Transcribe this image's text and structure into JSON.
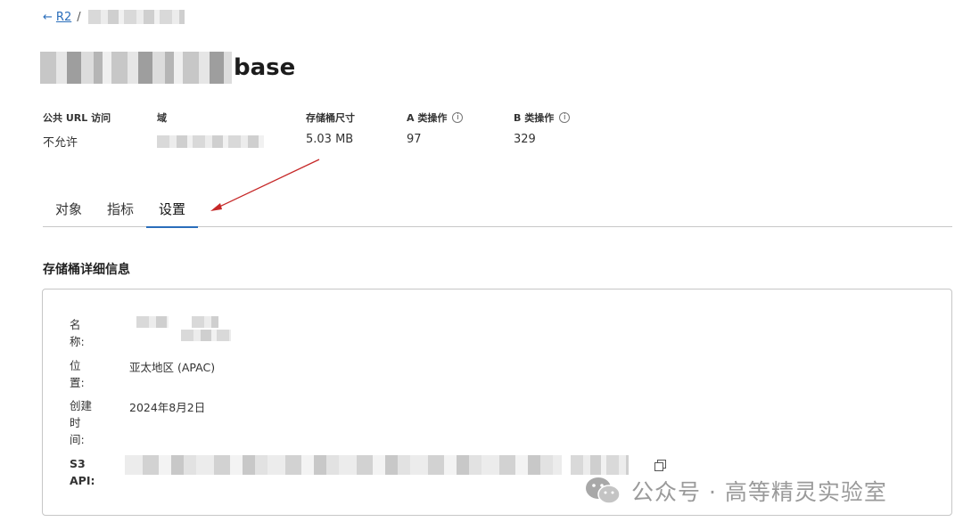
{
  "breadcrumb": {
    "back_label": "R2",
    "separator": "/"
  },
  "title": {
    "suffix": "base"
  },
  "stats": [
    {
      "label": "公共 URL 访问",
      "value": "不允许"
    },
    {
      "label": "域",
      "value": ""
    },
    {
      "label": "存储桶尺寸",
      "value": "5.03 MB"
    },
    {
      "label": "A 类操作",
      "value": "97",
      "info": true
    },
    {
      "label": "B 类操作",
      "value": "329",
      "info": true
    }
  ],
  "tabs": [
    {
      "label": "对象",
      "active": false
    },
    {
      "label": "指标",
      "active": false
    },
    {
      "label": "设置",
      "active": true
    }
  ],
  "section": {
    "title": "存储桶详细信息"
  },
  "details": {
    "name_label": [
      "名",
      "称:"
    ],
    "location_label": [
      "位",
      "置:"
    ],
    "location_value": "亚太地区 (APAC)",
    "created_label": [
      "创建",
      "时",
      "间:"
    ],
    "created_value": "2024年8月2日",
    "s3_label": [
      "S3",
      "API:"
    ]
  },
  "watermark": {
    "text": "公众号 · 高等精灵实验室"
  },
  "colors": {
    "link": "#2a6ebb",
    "annotation_arrow": "#c62828",
    "border": "#c6c6c6"
  }
}
